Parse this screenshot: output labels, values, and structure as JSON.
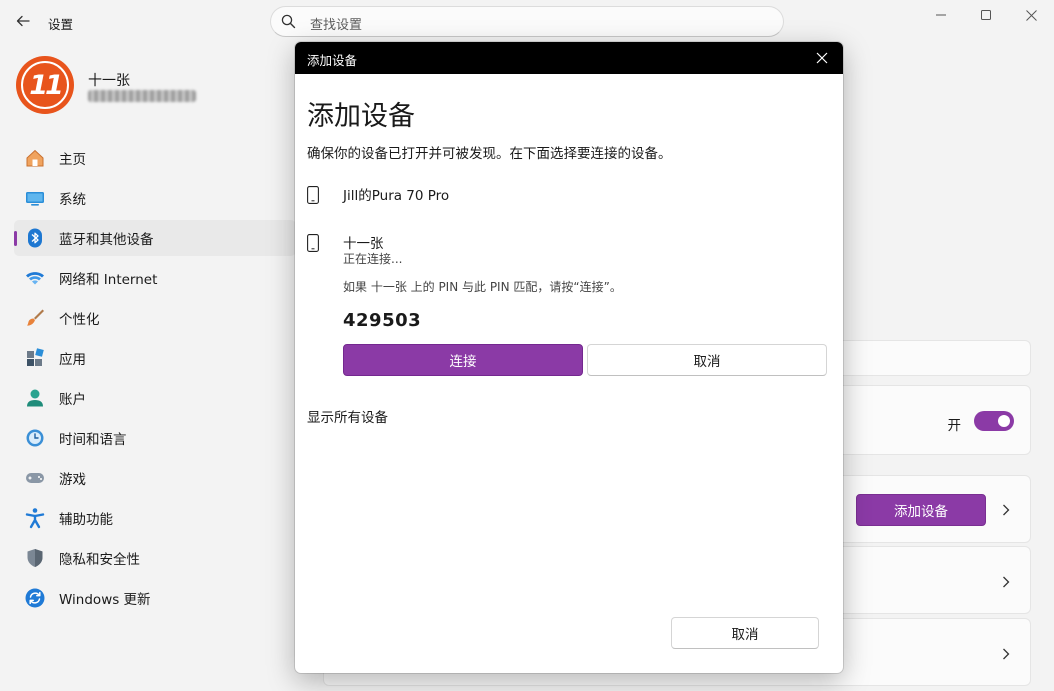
{
  "window": {
    "title": "设置",
    "search_placeholder": "查找设置"
  },
  "profile": {
    "logo_text": "11",
    "name": "十一张"
  },
  "sidebar": {
    "items": [
      {
        "label": "主页",
        "icon": "home-icon"
      },
      {
        "label": "系统",
        "icon": "system-icon"
      },
      {
        "label": "蓝牙和其他设备",
        "icon": "bluetooth-icon",
        "active": true
      },
      {
        "label": "网络和 Internet",
        "icon": "wifi-icon"
      },
      {
        "label": "个性化",
        "icon": "brush-icon"
      },
      {
        "label": "应用",
        "icon": "apps-icon"
      },
      {
        "label": "账户",
        "icon": "account-icon"
      },
      {
        "label": "时间和语言",
        "icon": "clock-globe-icon"
      },
      {
        "label": "游戏",
        "icon": "gamepad-icon"
      },
      {
        "label": "辅助功能",
        "icon": "accessibility-icon"
      },
      {
        "label": "隐私和安全性",
        "icon": "shield-icon"
      },
      {
        "label": "Windows 更新",
        "icon": "update-icon"
      }
    ]
  },
  "main": {
    "toggle_label": "开",
    "toggle_on": true,
    "add_device_label": "添加设备"
  },
  "dialog": {
    "titlebar": "添加设备",
    "heading": "添加设备",
    "description": "确保你的设备已打开并可被发现。在下面选择要连接的设备。",
    "devices": [
      {
        "name": "Jill的Pura 70 Pro",
        "status": ""
      },
      {
        "name": "十一张",
        "status": "正在连接..."
      }
    ],
    "pin_hint": "如果 十一张 上的 PIN 与此 PIN 匹配，请按“连接”。",
    "pin": "429503",
    "connect_label": "连接",
    "cancel_label": "取消",
    "show_all_label": "显示所有设备",
    "footer_cancel_label": "取消"
  },
  "colors": {
    "accent": "#8b3aa6",
    "logo": "#e8541c"
  }
}
